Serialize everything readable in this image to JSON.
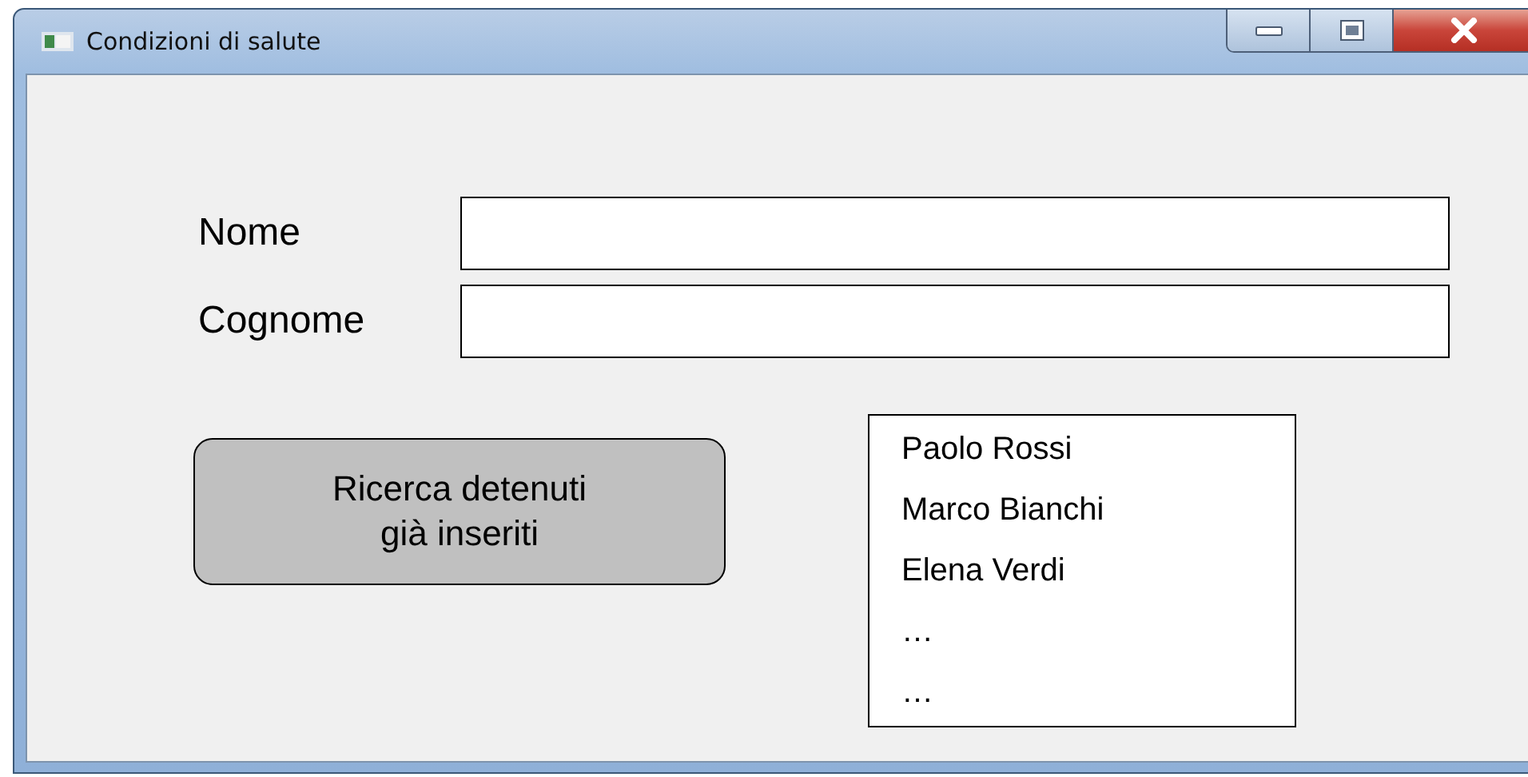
{
  "window": {
    "title": "Condizioni di salute"
  },
  "fields": [
    {
      "label": "Nome"
    },
    {
      "label": "Cognome"
    }
  ],
  "search_button": {
    "label": "Ricerca detenuti\ngià inseriti"
  },
  "list": {
    "items": [
      "Paolo Rossi",
      "Marco Bianchi",
      "Elena Verdi",
      "…",
      "…"
    ]
  }
}
